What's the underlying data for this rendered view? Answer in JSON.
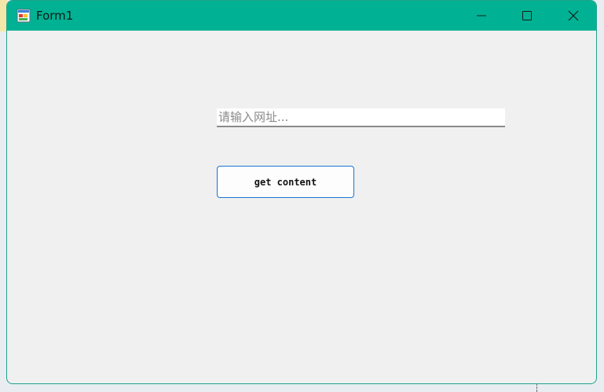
{
  "window": {
    "title": "Form1",
    "icon": "winforms-app-icon",
    "controls": {
      "minimize": "minimize-icon",
      "maximize": "maximize-icon",
      "close": "close-icon"
    },
    "titlebar_color": "#00b293",
    "background_color": "#f0f0f0"
  },
  "form": {
    "url_input": {
      "value": "",
      "placeholder": "请输入网址..."
    },
    "get_button": {
      "label": "get content",
      "border_color": "#1976d2"
    }
  }
}
